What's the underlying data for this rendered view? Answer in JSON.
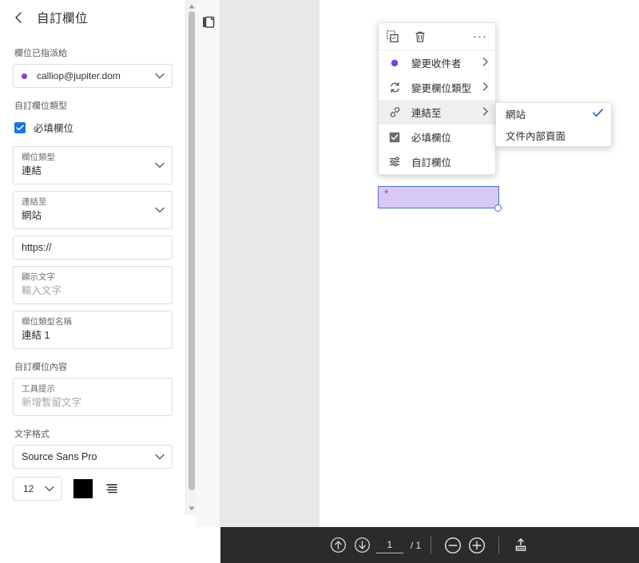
{
  "panel": {
    "title": "自訂欄位",
    "back_icon": "chevron-left-icon",
    "assigned_label": "欄位已指派給",
    "assignee_value": "calliop@jupiter.dom",
    "field_type_group_label": "自訂欄位類型",
    "required_checkbox_label": "必填欄位",
    "field_type": {
      "label": "欄位類型",
      "value": "連結"
    },
    "link_to": {
      "label": "連結至",
      "value": "網站"
    },
    "url": {
      "placeholder": "https://"
    },
    "display_text": {
      "label": "顯示文字",
      "placeholder": "輸入文字"
    },
    "field_name": {
      "label": "欄位類型名稱",
      "value": "連結 1"
    },
    "content_group_label": "自訂欄位內容",
    "tooltip": {
      "label": "工具提示",
      "placeholder": "新增暫留文字"
    },
    "text_format_label": "文字格式",
    "font_family": "Source Sans Pro",
    "font_size": "12",
    "font_color": "#000000",
    "align_icon": "text-align-icon"
  },
  "context_menu": {
    "toolbar": [
      {
        "name": "duplicate-icon",
        "label": "duplicate"
      },
      {
        "name": "delete-icon",
        "label": "delete"
      },
      {
        "name": "more-options-icon",
        "label": "···"
      }
    ],
    "items": [
      {
        "icon": "recipient-dot-icon",
        "label": "變更收件者",
        "arrow": "›",
        "highlighted": false
      },
      {
        "icon": "swap-field-type-icon",
        "label": "變更欄位類型",
        "arrow": "›",
        "highlighted": false
      },
      {
        "icon": "link-icon",
        "label": "連結至",
        "arrow": "›",
        "highlighted": true
      },
      {
        "icon": "checkbox-checked-icon",
        "label": "必填欄位",
        "arrow": "",
        "highlighted": false
      },
      {
        "icon": "sliders-icon",
        "label": "自訂欄位",
        "arrow": "",
        "highlighted": false
      }
    ],
    "submenu": [
      {
        "label": "網站",
        "checked": true
      },
      {
        "label": "文件內部頁面",
        "checked": false
      }
    ],
    "submenu_check_color": "#2a6fd0"
  },
  "document": {
    "field": {
      "required_marker": "*",
      "fill_color": "#d6c9f6",
      "border_color": "#4a6fc4"
    },
    "pages_icon": "pages-thumbnail-icon"
  },
  "bottom_bar": {
    "prev_page_icon": "arrow-up-circle-icon",
    "next_page_icon": "arrow-down-circle-icon",
    "page_number": "1",
    "page_total": "/ 1",
    "zoom_out_icon": "minus-circle-icon",
    "zoom_in_icon": "plus-circle-icon",
    "fit_page_icon": "fit-page-icon"
  }
}
